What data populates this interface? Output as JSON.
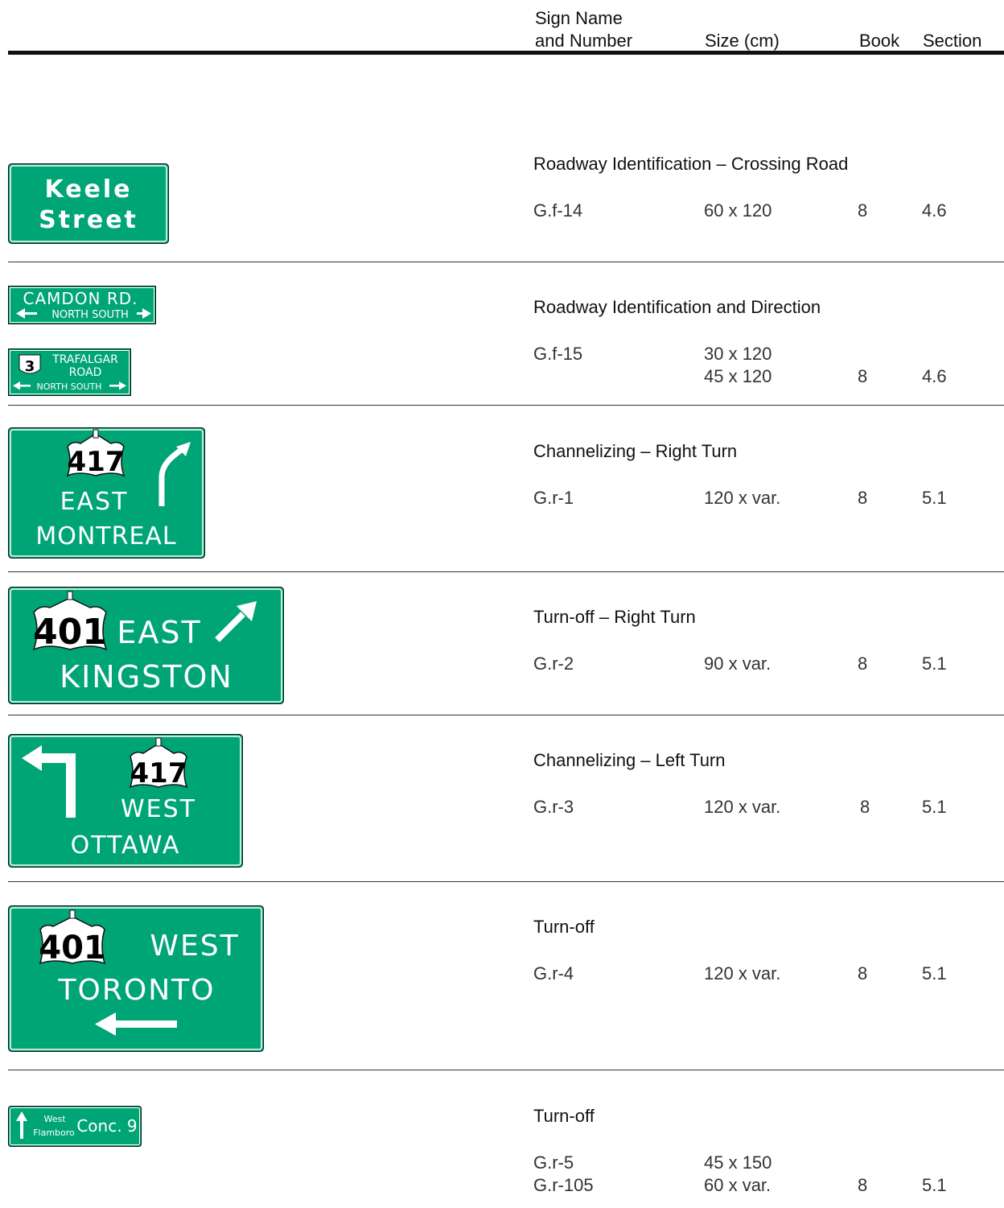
{
  "header": {
    "col_name_line1": "Sign Name",
    "col_name_line2": "and Number",
    "col_size": "Size (cm)",
    "col_book": "Book",
    "col_section": "Section"
  },
  "colors": {
    "sign_green": "#00A576",
    "text": "#111111"
  },
  "rows": [
    {
      "title": "Roadway Identification – Crossing Road",
      "numbers": [
        "G.f-14"
      ],
      "sizes": [
        "60 x 120"
      ],
      "book": "8",
      "section": "4.6",
      "sign": {
        "line1": "Keele",
        "line2": "Street"
      }
    },
    {
      "title": "Roadway Identification and Direction",
      "numbers": [
        "G.f-15"
      ],
      "sizes": [
        "30 x 120",
        "45 x 120"
      ],
      "book": "8",
      "section": "4.6",
      "sign_a": {
        "road": "CAMDON RD.",
        "directions": "NORTH SOUTH"
      },
      "sign_b": {
        "route": "3",
        "road_line1": "TRAFALGAR",
        "road_line2": "ROAD",
        "directions": "NORTH SOUTH"
      }
    },
    {
      "title": "Channelizing – Right Turn",
      "numbers": [
        "G.r-1"
      ],
      "sizes": [
        "120 x var."
      ],
      "book": "8",
      "section": "5.1",
      "sign": {
        "route": "417",
        "direction": "EAST",
        "destination": "MONTREAL",
        "arrow": "curved-right-turn-arrow"
      }
    },
    {
      "title": "Turn-off – Right Turn",
      "numbers": [
        "G.r-2"
      ],
      "sizes": [
        "90 x var."
      ],
      "book": "8",
      "section": "5.1",
      "sign": {
        "route": "401",
        "direction": "EAST",
        "destination": "KINGSTON",
        "arrow": "diagonal-up-right-arrow"
      }
    },
    {
      "title": "Channelizing – Left Turn",
      "numbers": [
        "G.r-3"
      ],
      "sizes": [
        "120 x var."
      ],
      "book": "8",
      "section": "5.1",
      "sign": {
        "route": "417",
        "direction": "WEST",
        "destination": "OTTAWA",
        "arrow": "left-turn-arrow"
      }
    },
    {
      "title": "Turn-off",
      "numbers": [
        "G.r-4"
      ],
      "sizes": [
        "120 x var."
      ],
      "book": "8",
      "section": "5.1",
      "sign": {
        "route": "401",
        "direction": "WEST",
        "destination": "TORONTO",
        "arrow": "left-arrow"
      }
    },
    {
      "title": "Turn-off",
      "numbers": [
        "G.r-5",
        "G.r-105"
      ],
      "sizes": [
        "45 x 150",
        "60 x var."
      ],
      "book": "8",
      "section": "5.1",
      "sign": {
        "place_line1": "West",
        "place_line2": "Flamboro",
        "road": "Conc. 9",
        "arrow": "up-arrow"
      }
    }
  ]
}
